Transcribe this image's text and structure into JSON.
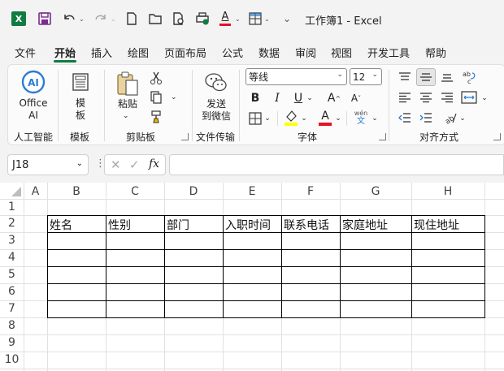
{
  "window": {
    "title": "工作簿1  -  Excel"
  },
  "tabs": [
    "文件",
    "开始",
    "插入",
    "绘图",
    "页面布局",
    "公式",
    "数据",
    "审阅",
    "视图",
    "开发工具",
    "帮助"
  ],
  "active_tab": "开始",
  "ribbon": {
    "office_ai": {
      "line1": "Office",
      "line2": "AI",
      "group": "人工智能"
    },
    "template": {
      "line1": "模",
      "line2": "板",
      "group": "模板"
    },
    "clipboard": {
      "paste": "粘贴",
      "group": "剪贴板"
    },
    "transfer": {
      "line1": "发送",
      "line2": "到微信",
      "group": "文件传输"
    },
    "font": {
      "name": "等线",
      "size": "12",
      "bold": "B",
      "italic": "I",
      "underline": "U",
      "grow": "A",
      "shrink": "A",
      "group": "字体",
      "pinyin_top": "wén",
      "pinyin_bottom": "文"
    },
    "alignment": {
      "group": "对齐方式"
    }
  },
  "colors": {
    "accent": "#107c41",
    "font_color": "#e81123",
    "highlight": "#ffff00"
  },
  "formula_bar": {
    "name_box": "J18",
    "fx": "fx",
    "formula": ""
  },
  "sheet": {
    "columns": [
      "A",
      "B",
      "C",
      "D",
      "E",
      "F",
      "G",
      "H"
    ],
    "rows": [
      "1",
      "2",
      "3",
      "4",
      "5",
      "6",
      "7",
      "8",
      "9",
      "10"
    ],
    "headers": [
      "姓名",
      "性别",
      "部门",
      "入职时间",
      "联系电话",
      "家庭地址",
      "现住地址"
    ]
  }
}
